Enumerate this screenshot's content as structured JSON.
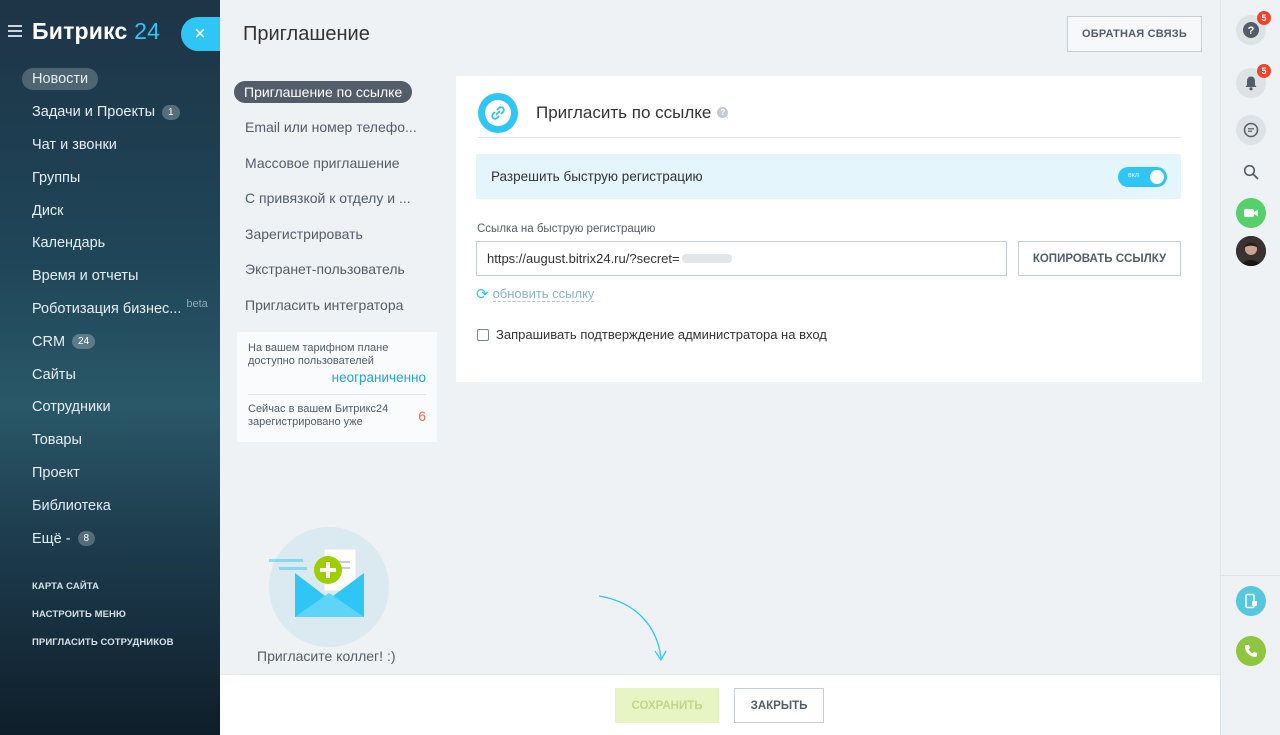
{
  "sidebar": {
    "logo_main": "Битрикс",
    "logo_num": "24",
    "close_icon": "×",
    "items": [
      {
        "label": "Новости",
        "active": true
      },
      {
        "label": "Задачи и Проекты",
        "counter": "1"
      },
      {
        "label": "Чат и звонки"
      },
      {
        "label": "Группы"
      },
      {
        "label": "Диск"
      },
      {
        "label": "Календарь"
      },
      {
        "label": "Время и отчеты"
      },
      {
        "label": "Роботизация бизнес...",
        "badge": "beta"
      },
      {
        "label": "CRM",
        "counter": "24"
      },
      {
        "label": "Сайты"
      },
      {
        "label": "Сотрудники"
      },
      {
        "label": "Товары"
      },
      {
        "label": "Проект"
      },
      {
        "label": "Библиотека"
      },
      {
        "label": "Ещё -",
        "counter": "8"
      }
    ],
    "links": [
      "КАРТА САЙТА",
      "НАСТРОИТЬ МЕНЮ",
      "ПРИГЛАСИТЬ СОТРУДНИКОВ"
    ]
  },
  "panel": {
    "title": "Приглашение",
    "feedback_label": "ОБРАТНАЯ СВЯЗЬ",
    "tabs": [
      "Приглашение по ссылке",
      "Email или номер телефо...",
      "Массовое приглашение",
      "С привязкой к отделу и ...",
      "Зарегистрировать",
      "Экстранет-пользователь",
      "Пригласить интегратора"
    ],
    "info": {
      "plan_text": "На вашем тарифном плане доступно пользователей",
      "plan_value": "неограниченно",
      "registered_text": "Сейчас в вашем Битрикс24 зарегистрировано уже",
      "registered_value": "6"
    },
    "illustration_caption": "Пригласите коллег! :)",
    "card": {
      "title": "Пригласить по ссылке",
      "fast_reg_label": "Разрешить быструю регистрацию",
      "toggle_text": "вкл",
      "toggle_on": true,
      "field_label": "Ссылка на быструю регистрацию",
      "url_value": "https://august.bitrix24.ru/?secret=",
      "copy_label": "КОПИРОВАТЬ ССЫЛКУ",
      "refresh_label": "обновить ссылку",
      "confirm_label": "Запрашивать подтверждение администратора на вход",
      "confirm_checked": false
    },
    "footer": {
      "save_label": "СОХРАНИТЬ",
      "close_label": "ЗАКРЫТЬ"
    }
  },
  "rail": {
    "help_badge": "5",
    "notify_badge": "5"
  },
  "colors": {
    "accent": "#2fc6f6",
    "save_disabled": "#e7f4c3",
    "badge": "#f0412c",
    "green": "#55d0e0"
  }
}
